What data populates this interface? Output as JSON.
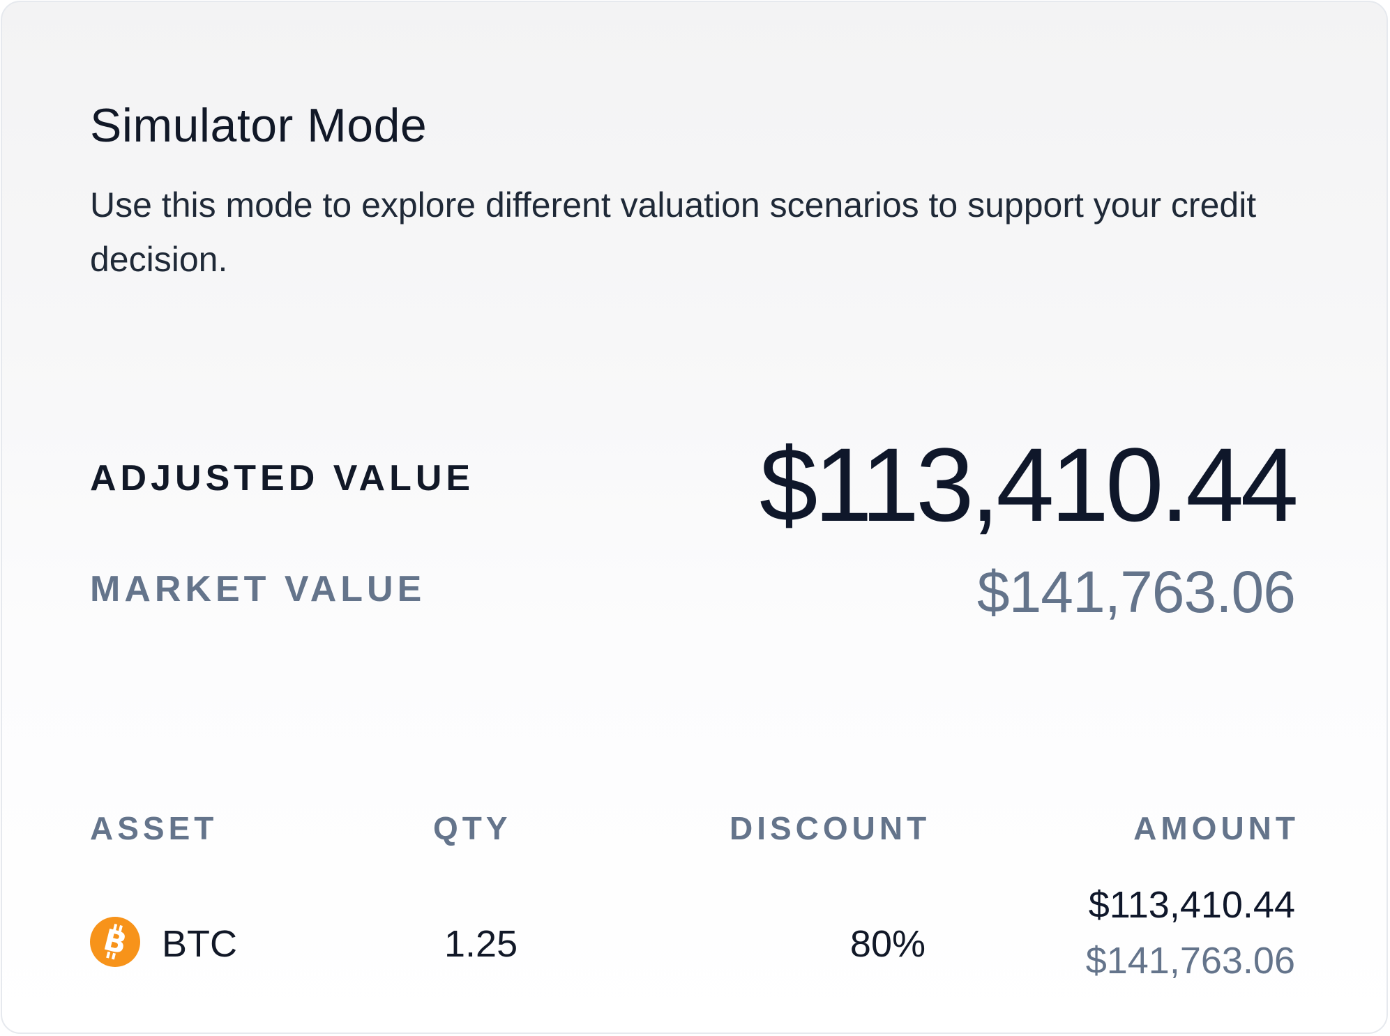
{
  "panel": {
    "title": "Simulator Mode",
    "description": "Use this mode to explore different valuation scenarios to support your credit decision."
  },
  "summary": {
    "adjusted_label": "ADJUSTED VALUE",
    "adjusted_value": "$113,410.44",
    "market_label": "MARKET VALUE",
    "market_value": "$141,763.06"
  },
  "table": {
    "headers": {
      "asset": "ASSET",
      "qty": "QTY",
      "discount": "DISCOUNT",
      "amount": "AMOUNT"
    },
    "rows": [
      {
        "asset": "BTC",
        "icon": "bitcoin-icon",
        "icon_color": "#f7931a",
        "qty": "1.25",
        "discount": "80%",
        "amount_adjusted": "$113,410.44",
        "amount_market": "$141,763.06"
      }
    ]
  },
  "colors": {
    "primary_text": "#111827",
    "muted_text": "#64748b",
    "bitcoin": "#f7931a"
  }
}
